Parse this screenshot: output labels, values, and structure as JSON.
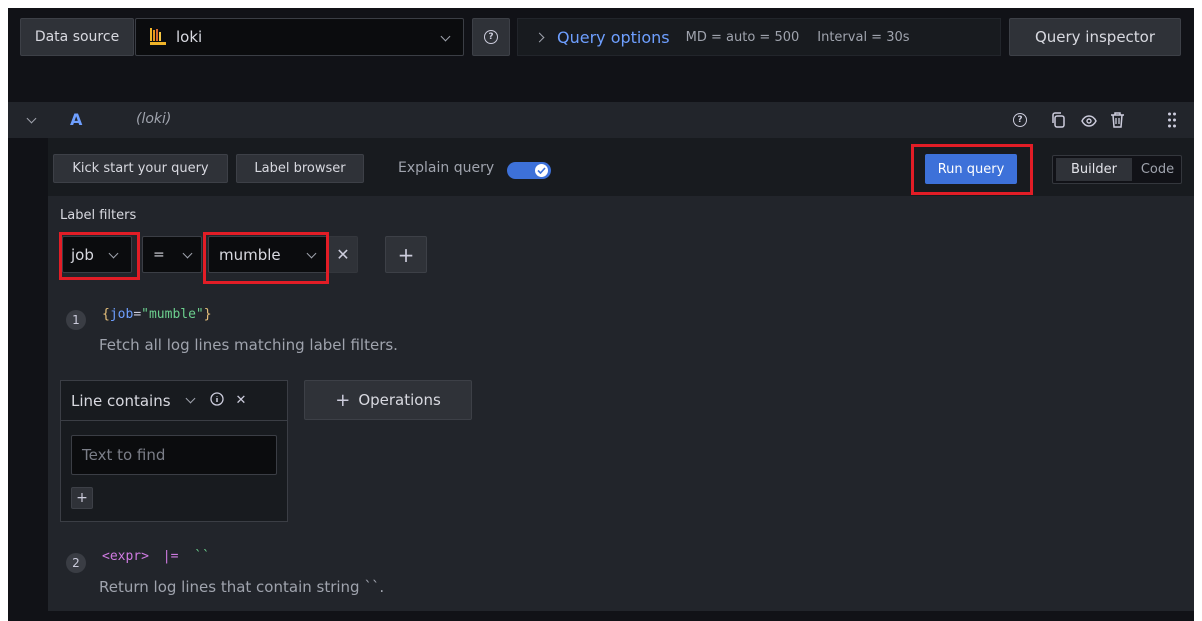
{
  "toolbar": {
    "datasource_label": "Data source",
    "datasource_value": "loki",
    "query_options_label": "Query options",
    "md_info": "MD = auto = 500",
    "interval_info": "Interval = 30s",
    "query_inspector_label": "Query inspector"
  },
  "query_row": {
    "ref_id": "A",
    "datasource_name": "(loki)"
  },
  "query_header": {
    "kick_start_label": "Kick start your query",
    "label_browser_label": "Label browser",
    "explain_query_label": "Explain query",
    "explain_enabled": true,
    "run_query_label": "Run query",
    "builder_label": "Builder",
    "code_label": "Code",
    "mode": "Builder"
  },
  "label_filters": {
    "title": "Label filters",
    "label": "job",
    "operator": "=",
    "value": "mumble"
  },
  "steps": [
    {
      "num": "1",
      "expr_open": "{",
      "expr_key": "job",
      "expr_eq": "=",
      "expr_val": "\"mumble\"",
      "expr_close": "}",
      "description": "Fetch all log lines matching label filters."
    },
    {
      "num": "2",
      "expr_tag": "<expr>",
      "expr_op": "|=",
      "expr_str": "``",
      "description": "Return log lines that contain string ``."
    }
  ],
  "operation": {
    "name": "Line contains",
    "placeholder": "Text to find",
    "add_operations_label": "Operations"
  },
  "colors": {
    "accent_blue": "#6e9fff",
    "primary_button": "#3d71d9",
    "highlight_red": "#e21d26",
    "code_green": "#6ccf8e",
    "code_purple": "#d07be2"
  }
}
